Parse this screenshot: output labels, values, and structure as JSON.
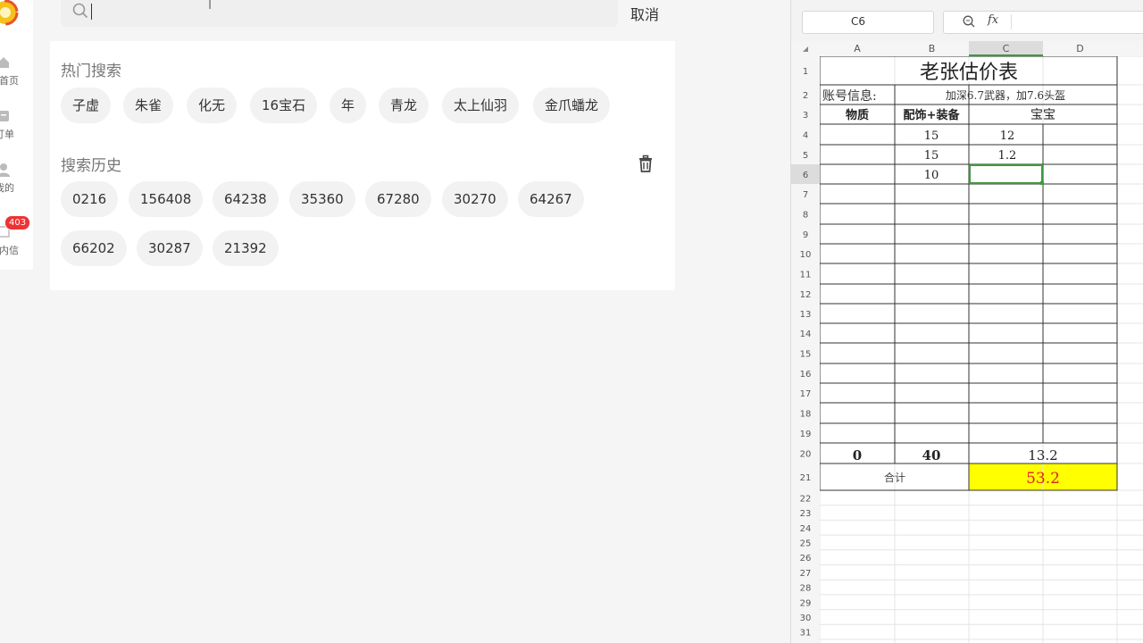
{
  "sidebar": {
    "items": [
      {
        "label": "首页",
        "icon": "home-icon"
      },
      {
        "label": "订单",
        "icon": "order-icon"
      },
      {
        "label": "我的",
        "icon": "user-icon"
      },
      {
        "label": "站内信",
        "icon": "mail-icon",
        "badge": "403"
      }
    ],
    "badge_color": "#ee3333"
  },
  "search": {
    "placeholder": "",
    "value": "",
    "cancel_label": "取消"
  },
  "hot_search": {
    "title": "热门搜索",
    "tags": [
      "子虚",
      "朱雀",
      "化无",
      "16宝石",
      "年",
      "青龙",
      "太上仙羽",
      "金爪蟠龙"
    ]
  },
  "history": {
    "title": "搜索历史",
    "tags": [
      "0216",
      "156408",
      "64238",
      "35360",
      "67280",
      "30270",
      "64267",
      "66202",
      "30287",
      "21392"
    ]
  },
  "spreadsheet": {
    "name_box": "C6",
    "fx_label": "fx",
    "columns": [
      "A",
      "B",
      "C",
      "D"
    ],
    "rows": [
      "1",
      "2",
      "3",
      "4",
      "5",
      "6",
      "7",
      "8",
      "9",
      "10",
      "11",
      "12",
      "13",
      "14",
      "15",
      "16",
      "17",
      "18",
      "19",
      "20",
      "21",
      "22",
      "23",
      "24",
      "25",
      "26",
      "27",
      "28",
      "29",
      "30",
      "31"
    ],
    "title": "老张估价表",
    "account_label": "账号信息:",
    "account_value": "加深6.7武器，加7.6头盔",
    "headers": [
      "物质",
      "配饰+装备",
      "宝宝"
    ],
    "values": {
      "B4": "15",
      "C4": "12",
      "B5": "15",
      "C5": "1.2",
      "B6": "10"
    },
    "sums": {
      "A": "0",
      "B": "40",
      "C": "13.2"
    },
    "total_label": "合计",
    "total_value": "53.2",
    "total_fill": "#ffff00",
    "total_text_color": "#e02020",
    "selection_color": "#3c9a3c"
  }
}
